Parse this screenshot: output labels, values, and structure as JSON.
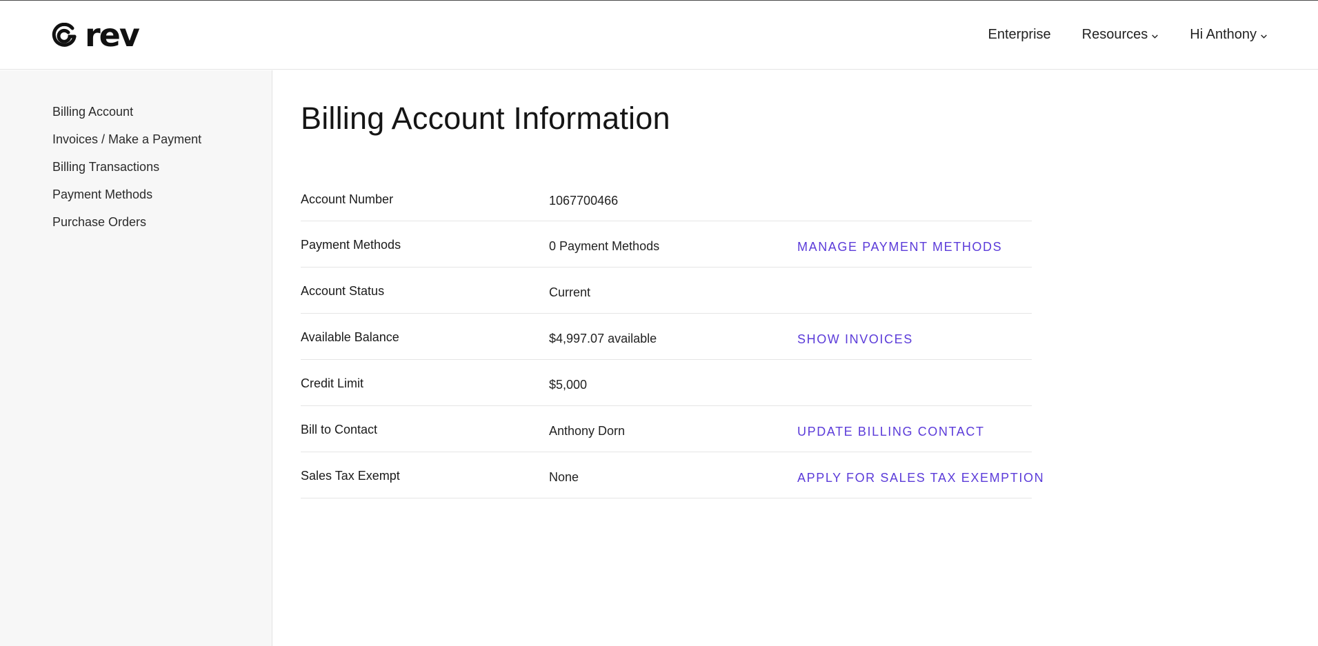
{
  "header": {
    "logo_text": "rev",
    "nav": [
      {
        "label": "Enterprise",
        "has_dropdown": false
      },
      {
        "label": "Resources",
        "has_dropdown": true
      },
      {
        "label": "Hi Anthony",
        "has_dropdown": true
      }
    ]
  },
  "sidebar": {
    "items": [
      {
        "label": "Billing Account"
      },
      {
        "label": "Invoices / Make a Payment"
      },
      {
        "label": "Billing Transactions"
      },
      {
        "label": "Payment Methods"
      },
      {
        "label": "Purchase Orders"
      }
    ]
  },
  "main": {
    "title": "Billing Account Information",
    "rows": [
      {
        "label": "Account Number",
        "value": "1067700466",
        "action": ""
      },
      {
        "label": "Payment Methods",
        "value": "0 Payment Methods",
        "action": "MANAGE PAYMENT METHODS"
      },
      {
        "label": "Account Status",
        "value": "Current",
        "action": ""
      },
      {
        "label": "Available Balance",
        "value": "$4,997.07 available",
        "action": "SHOW INVOICES"
      },
      {
        "label": "Credit Limit",
        "value": "$5,000",
        "action": ""
      },
      {
        "label": "Bill to Contact",
        "value": "Anthony Dorn",
        "action": "UPDATE BILLING CONTACT"
      },
      {
        "label": "Sales Tax Exempt",
        "value": "None",
        "action": "APPLY FOR SALES TAX EXEMPTION"
      }
    ]
  },
  "colors": {
    "accent": "#5b3bd9",
    "sidebar_bg": "#f7f7f7",
    "divider": "#e5e5e5"
  },
  "icons": {
    "logo": "rev-swirl-icon",
    "dropdown": "chevron-down-icon"
  }
}
